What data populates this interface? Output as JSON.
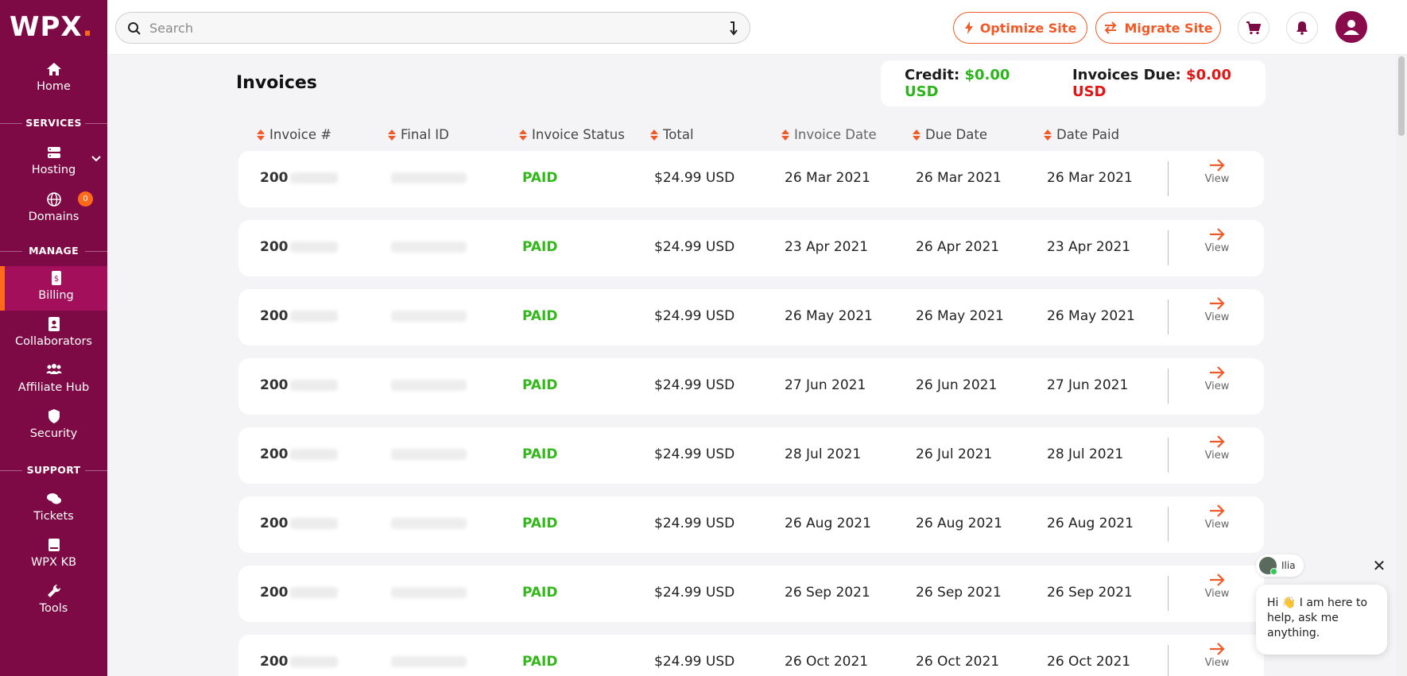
{
  "brand": {
    "logo_text": "WPX",
    "logo_dot": ".",
    "accent": "#f05a28",
    "sidebar_bg": "#7d0a45"
  },
  "sidebar": {
    "home": "Home",
    "services_label": "SERVICES",
    "hosting": "Hosting",
    "domains": "Domains",
    "domains_badge": "0",
    "manage_label": "MANAGE",
    "billing": "Billing",
    "collaborators": "Collaborators",
    "affiliate_hub": "Affiliate Hub",
    "security": "Security",
    "support_label": "SUPPORT",
    "tickets": "Tickets",
    "wpx_kb": "WPX KB",
    "tools": "Tools"
  },
  "topbar": {
    "search_placeholder": "Search",
    "optimize_label": "Optimize Site",
    "migrate_label": "Migrate Site"
  },
  "main": {
    "title": "Invoices",
    "credit_label": "Credit:",
    "credit_value": "$0.00 USD",
    "due_label": "Invoices Due:",
    "due_value": "$0.00 USD"
  },
  "table": {
    "headers": [
      "Invoice #",
      "Final ID",
      "Invoice Status",
      "Total",
      "Invoice Date",
      "Due Date",
      "Date Paid"
    ],
    "view_label": "View",
    "rows": [
      {
        "invoice": "200",
        "status": "PAID",
        "total": "$24.99 USD",
        "invoice_date": "26 Mar 2021",
        "due_date": "26 Mar 2021",
        "date_paid": "26 Mar 2021"
      },
      {
        "invoice": "200",
        "status": "PAID",
        "total": "$24.99 USD",
        "invoice_date": "23 Apr 2021",
        "due_date": "26 Apr 2021",
        "date_paid": "23 Apr 2021"
      },
      {
        "invoice": "200",
        "status": "PAID",
        "total": "$24.99 USD",
        "invoice_date": "26 May 2021",
        "due_date": "26 May 2021",
        "date_paid": "26 May 2021"
      },
      {
        "invoice": "200",
        "status": "PAID",
        "total": "$24.99 USD",
        "invoice_date": "27 Jun 2021",
        "due_date": "26 Jun 2021",
        "date_paid": "27 Jun 2021"
      },
      {
        "invoice": "200",
        "status": "PAID",
        "total": "$24.99 USD",
        "invoice_date": "28 Jul 2021",
        "due_date": "26 Jul 2021",
        "date_paid": "28 Jul 2021"
      },
      {
        "invoice": "200",
        "status": "PAID",
        "total": "$24.99 USD",
        "invoice_date": "26 Aug 2021",
        "due_date": "26 Aug 2021",
        "date_paid": "26 Aug 2021"
      },
      {
        "invoice": "200",
        "status": "PAID",
        "total": "$24.99 USD",
        "invoice_date": "26 Sep 2021",
        "due_date": "26 Sep 2021",
        "date_paid": "26 Sep 2021"
      },
      {
        "invoice": "200",
        "status": "PAID",
        "total": "$24.99 USD",
        "invoice_date": "26 Oct 2021",
        "due_date": "26 Oct 2021",
        "date_paid": "26 Oct 2021"
      }
    ]
  },
  "chat": {
    "agent_name": "Ilia",
    "message": "Hi 👋 I am here to help, ask me anything."
  }
}
